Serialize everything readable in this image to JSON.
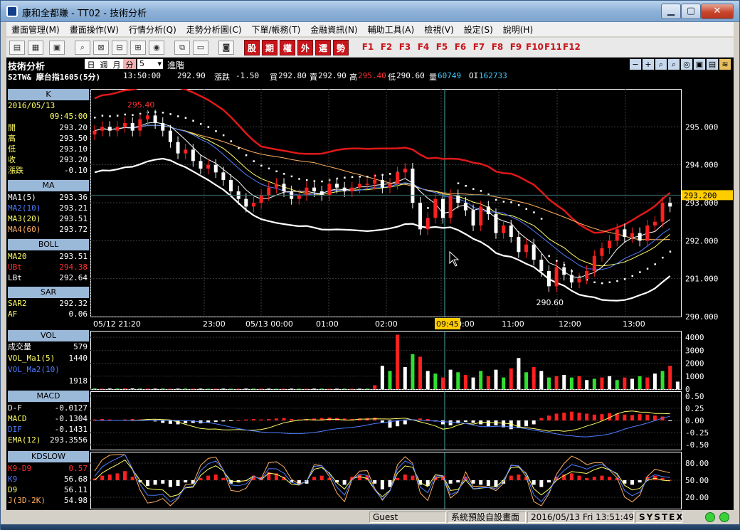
{
  "window": {
    "title": "康和全都賺 - TT02 - 技術分析",
    "min_label": "▁",
    "max_label": "▢",
    "close_label": "✕"
  },
  "menu": [
    "畫面管理(M)",
    "畫面操作(W)",
    "行情分析(Q)",
    "走勢分析圖(C)",
    "下單/帳務(T)",
    "金融資訊(N)",
    "輔助工具(A)",
    "檢視(V)",
    "設定(S)",
    "說明(H)"
  ],
  "toolbar": {
    "big_buttons": [
      "股",
      "期",
      "權",
      "外",
      "選",
      "勢"
    ],
    "fkeys": [
      "F1",
      "F2",
      "F3",
      "F4",
      "F5",
      "F6",
      "F7",
      "F8",
      "F9",
      "F10",
      "F11",
      "F12"
    ]
  },
  "header": {
    "section_title": "技術分析",
    "period_tabs": [
      "日",
      "週",
      "月",
      "分"
    ],
    "active_tab": "分",
    "interval_value": "5",
    "advanced_label": "進階",
    "symbol": "S2TW& 摩台指1605(5分)",
    "time": "13:50:00",
    "price": "292.90",
    "change_label": "漲跌",
    "change": "-1.50",
    "bid_label": "買",
    "bid": "292.80",
    "ask_label": "賣",
    "ask": "292.90",
    "high_label": "高",
    "high": "295.40",
    "low_label": "低",
    "low": "290.60",
    "volume_label": "量",
    "volume": "60749",
    "oi_label": "OI",
    "oi": "162733"
  },
  "panel": {
    "k": {
      "title": "K",
      "date": "2016/05/13",
      "time": "09:45:00",
      "rows": [
        {
          "label": "開",
          "value": "293.20"
        },
        {
          "label": "高",
          "value": "293.50"
        },
        {
          "label": "低",
          "value": "293.10"
        },
        {
          "label": "收",
          "value": "293.20"
        },
        {
          "label": "漲跌",
          "value": "-0.10"
        }
      ]
    },
    "ma": {
      "title": "MA",
      "rows": [
        {
          "label": "MA1(5)",
          "value": "293.36",
          "color": "#ffffff"
        },
        {
          "label": "MA2(10)",
          "value": "293.21",
          "color": "#4d7cff"
        },
        {
          "label": "MA3(20)",
          "value": "293.51",
          "color": "#ffff66"
        },
        {
          "label": "MA4(60)",
          "value": "293.72",
          "color": "#ffb060"
        }
      ]
    },
    "boll": {
      "title": "BOLL",
      "rows": [
        {
          "label": "MA20",
          "value": "293.51",
          "color": "#ffff66"
        },
        {
          "label": "UBt",
          "value": "294.38",
          "color": "#ff3030"
        },
        {
          "label": "LBt",
          "value": "292.64",
          "color": "#ffffff"
        }
      ]
    },
    "sar": {
      "title": "SAR",
      "rows": [
        {
          "label": "SAR2",
          "value": "292.32",
          "color": "#ffff66"
        },
        {
          "label": "AF",
          "value": "0.06",
          "color": "#ffff66"
        }
      ]
    },
    "vol": {
      "title": "VOL",
      "rows": [
        {
          "label": "成交量",
          "value": "579",
          "color": "#ffffff"
        },
        {
          "label": "VOL_Ma1(5)",
          "value": "1440",
          "color": "#ffff66"
        },
        {
          "label": "VOL_Ma2(10)",
          "value": "",
          "color": "#4d7cff"
        },
        {
          "label": "",
          "value": "1918",
          "color": "#4d7cff"
        }
      ]
    },
    "macd": {
      "title": "MACD",
      "rows": [
        {
          "label": "D-F",
          "value": "-0.0127",
          "color": "#ffffff"
        },
        {
          "label": "MACD",
          "value": "-0.1304",
          "color": "#ffff66"
        },
        {
          "label": "DIF",
          "value": "-0.1431",
          "color": "#4d7cff"
        },
        {
          "label": "EMA(12)",
          "value": "293.3556",
          "color": "#ffff66"
        }
      ]
    },
    "kd": {
      "title": "KDSLOW",
      "rows": [
        {
          "label": "K9-D9",
          "value": "0.57",
          "color": "#ff3030"
        },
        {
          "label": "K9",
          "value": "56.68",
          "color": "#4d7cff"
        },
        {
          "label": "D9",
          "value": "56.11",
          "color": "#ffff66"
        },
        {
          "label": "J(3D-2K)",
          "value": "54.98",
          "color": "#ffb060"
        }
      ]
    }
  },
  "chart_data": [
    {
      "type": "candlestick",
      "panel": "K",
      "ylim": [
        290.0,
        296.0
      ],
      "yticks": [
        "290.000",
        "291.000",
        "292.000",
        "293.000",
        "294.000",
        "295.000"
      ],
      "xticks": [
        "05/12 21:20",
        "23:00",
        "05/13 00:00",
        "01:00",
        "02:00",
        "09:45",
        "10:00",
        "11:00",
        "12:00",
        "13:00"
      ],
      "cursor_label": "09:45",
      "price_tag": "293.200",
      "annotations": [
        {
          "text": "295.40",
          "value": 295.4
        },
        {
          "text": "290.60",
          "value": 290.6
        }
      ],
      "close": [
        294.9,
        295.0,
        294.9,
        295.0,
        295.1,
        294.9,
        295.2,
        295.3,
        295.1,
        294.9,
        294.6,
        294.3,
        294.4,
        294.1,
        293.9,
        294.0,
        293.8,
        293.6,
        293.3,
        293.1,
        292.9,
        293.0,
        293.2,
        293.4,
        293.5,
        293.3,
        293.1,
        293.2,
        293.4,
        293.3,
        293.2,
        293.5,
        293.4,
        293.3,
        293.4,
        293.5,
        293.5,
        293.6,
        293.4,
        293.5,
        293.8,
        293.9,
        293.0,
        292.3,
        292.6,
        293.1,
        292.6,
        293.2,
        293.0,
        292.8,
        292.4,
        292.9,
        292.7,
        292.2,
        292.4,
        292.1,
        291.7,
        291.9,
        291.5,
        291.2,
        290.8,
        291.3,
        291.1,
        290.9,
        291.0,
        291.2,
        291.6,
        291.8,
        292.0,
        292.3,
        292.1,
        292.2,
        292.0,
        292.4,
        292.5,
        293.0,
        292.9
      ],
      "bollinger": {
        "upper": 294.38,
        "middle": 293.51,
        "lower": 292.64
      },
      "ma_lines": [
        "MA1(5)",
        "MA2(10)",
        "MA3(20)",
        "MA4(60)"
      ]
    },
    {
      "type": "bar",
      "panel": "VOL",
      "ylim": [
        0,
        4500
      ],
      "yticks": [
        "0",
        "1000",
        "2000",
        "3000",
        "4000"
      ],
      "values": [
        60,
        40,
        50,
        45,
        70,
        60,
        55,
        45,
        40,
        50,
        35,
        40,
        45,
        35,
        40,
        30,
        35,
        40,
        30,
        35,
        45,
        40,
        35,
        40,
        30,
        35,
        40,
        30,
        35,
        40,
        45,
        30,
        35,
        40,
        30,
        35,
        40,
        300,
        1800,
        1400,
        4200,
        1700,
        2700,
        2500,
        1400,
        1200,
        900,
        1500,
        1300,
        1100,
        900,
        1400,
        1000,
        1500,
        900,
        1600,
        2400,
        1300,
        1700,
        1400,
        900,
        1000,
        1100,
        900,
        1000,
        700,
        800,
        900,
        1000,
        700,
        900,
        800,
        1000,
        900,
        1200,
        1400,
        1800,
        579
      ]
    },
    {
      "type": "bar",
      "panel": "MACD",
      "ylim": [
        -0.6,
        0.6
      ],
      "yticks": [
        "-0.50",
        "-0.25",
        "0.00",
        "0.25",
        "0.50"
      ],
      "values": [
        0.02,
        0.03,
        0.02,
        0.01,
        0.02,
        0.03,
        0.02,
        0.01,
        -0.02,
        -0.05,
        -0.07,
        -0.08,
        -0.06,
        -0.05,
        -0.06,
        -0.04,
        -0.03,
        -0.02,
        -0.01,
        0.0,
        0.02,
        0.03,
        0.02,
        0.03,
        0.04,
        0.05,
        0.03,
        0.02,
        0.03,
        0.04,
        0.05,
        0.06,
        0.05,
        0.04,
        0.03,
        0.04,
        0.05,
        0.06,
        -0.05,
        -0.15,
        -0.12,
        -0.08,
        0.02,
        0.04,
        0.03,
        -0.02,
        -0.08,
        -0.1,
        -0.06,
        -0.03,
        -0.05,
        -0.08,
        -0.12,
        -0.1,
        -0.14,
        -0.18,
        -0.16,
        -0.12,
        -0.08,
        0.05,
        0.1,
        0.14,
        0.16,
        0.18,
        0.16,
        0.14,
        0.12,
        0.13,
        0.15,
        0.14,
        0.12,
        0.11,
        0.13,
        0.12,
        0.1,
        0.08,
        -0.0127
      ]
    },
    {
      "type": "bar",
      "panel": "KDSLOW",
      "ylim": [
        0,
        100
      ],
      "yticks": [
        "20.00",
        "50.00",
        "80.00"
      ],
      "values": [
        3,
        8,
        10,
        12,
        16,
        6,
        -4,
        -10,
        -8,
        -6,
        -12,
        -10,
        -4,
        -6,
        4,
        8,
        10,
        4,
        -6,
        -4,
        0,
        8,
        6,
        14,
        12,
        6,
        -4,
        -8,
        -6,
        6,
        8,
        4,
        -4,
        -8,
        6,
        10,
        8,
        -6,
        -16,
        -12,
        4,
        10,
        8,
        -8,
        -10,
        6,
        8,
        -6,
        -4,
        6,
        -6,
        -8,
        -10,
        -12,
        -6,
        8,
        10,
        6,
        -8,
        -12,
        -4,
        6,
        10,
        12,
        8,
        4,
        6,
        8,
        6,
        4,
        -6,
        -8,
        -4,
        6,
        8,
        4,
        0.57
      ]
    }
  ],
  "status": {
    "user": "Guest",
    "layout": "系統預設自設畫面",
    "datetime": "2016/05/13 Fri 13:51:49",
    "brand": "SYSTEX"
  }
}
